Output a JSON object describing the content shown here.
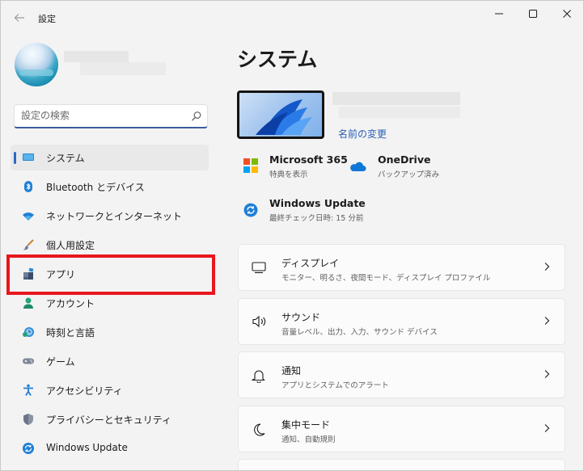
{
  "titlebar": {
    "app_title": "設定"
  },
  "search": {
    "placeholder": "設定の検索"
  },
  "sidebar": {
    "items": [
      {
        "label": "システム",
        "icon": "display-icon"
      },
      {
        "label": "Bluetooth とデバイス",
        "icon": "bluetooth-icon"
      },
      {
        "label": "ネットワークとインターネット",
        "icon": "wifi-icon"
      },
      {
        "label": "個人用設定",
        "icon": "paint-brush-icon"
      },
      {
        "label": "アプリ",
        "icon": "apps-icon"
      },
      {
        "label": "アカウント",
        "icon": "person-icon"
      },
      {
        "label": "時刻と言語",
        "icon": "clock-globe-icon"
      },
      {
        "label": "ゲーム",
        "icon": "gamepad-icon"
      },
      {
        "label": "アクセシビリティ",
        "icon": "accessibility-icon"
      },
      {
        "label": "プライバシーとセキュリティ",
        "icon": "shield-icon"
      },
      {
        "label": "Windows Update",
        "icon": "update-icon"
      }
    ],
    "selected_index": 0,
    "highlighted_index": 4
  },
  "main": {
    "title": "システム",
    "rename_link": "名前の変更",
    "quick": [
      {
        "title": "Microsoft 365",
        "subtitle": "特典を表示",
        "icon": "microsoft-logo-icon"
      },
      {
        "title": "OneDrive",
        "subtitle": "バックアップ済み",
        "icon": "onedrive-cloud-icon"
      },
      {
        "title": "Windows Update",
        "subtitle": "最終チェック日時: 15 分前",
        "icon": "windows-update-icon"
      }
    ],
    "cards": [
      {
        "title": "ディスプレイ",
        "subtitle": "モニター、明るさ、夜間モード、ディスプレイ プロファイル",
        "icon": "monitor-icon"
      },
      {
        "title": "サウンド",
        "subtitle": "音量レベル、出力、入力、サウンド デバイス",
        "icon": "speaker-icon"
      },
      {
        "title": "通知",
        "subtitle": "アプリとシステムでのアラート",
        "icon": "bell-icon"
      },
      {
        "title": "集中モード",
        "subtitle": "通知、自動規則",
        "icon": "moon-icon"
      }
    ]
  },
  "colors": {
    "accent": "#2b67c6",
    "highlight_red": "#e8171c",
    "link": "#2b5fb4"
  }
}
